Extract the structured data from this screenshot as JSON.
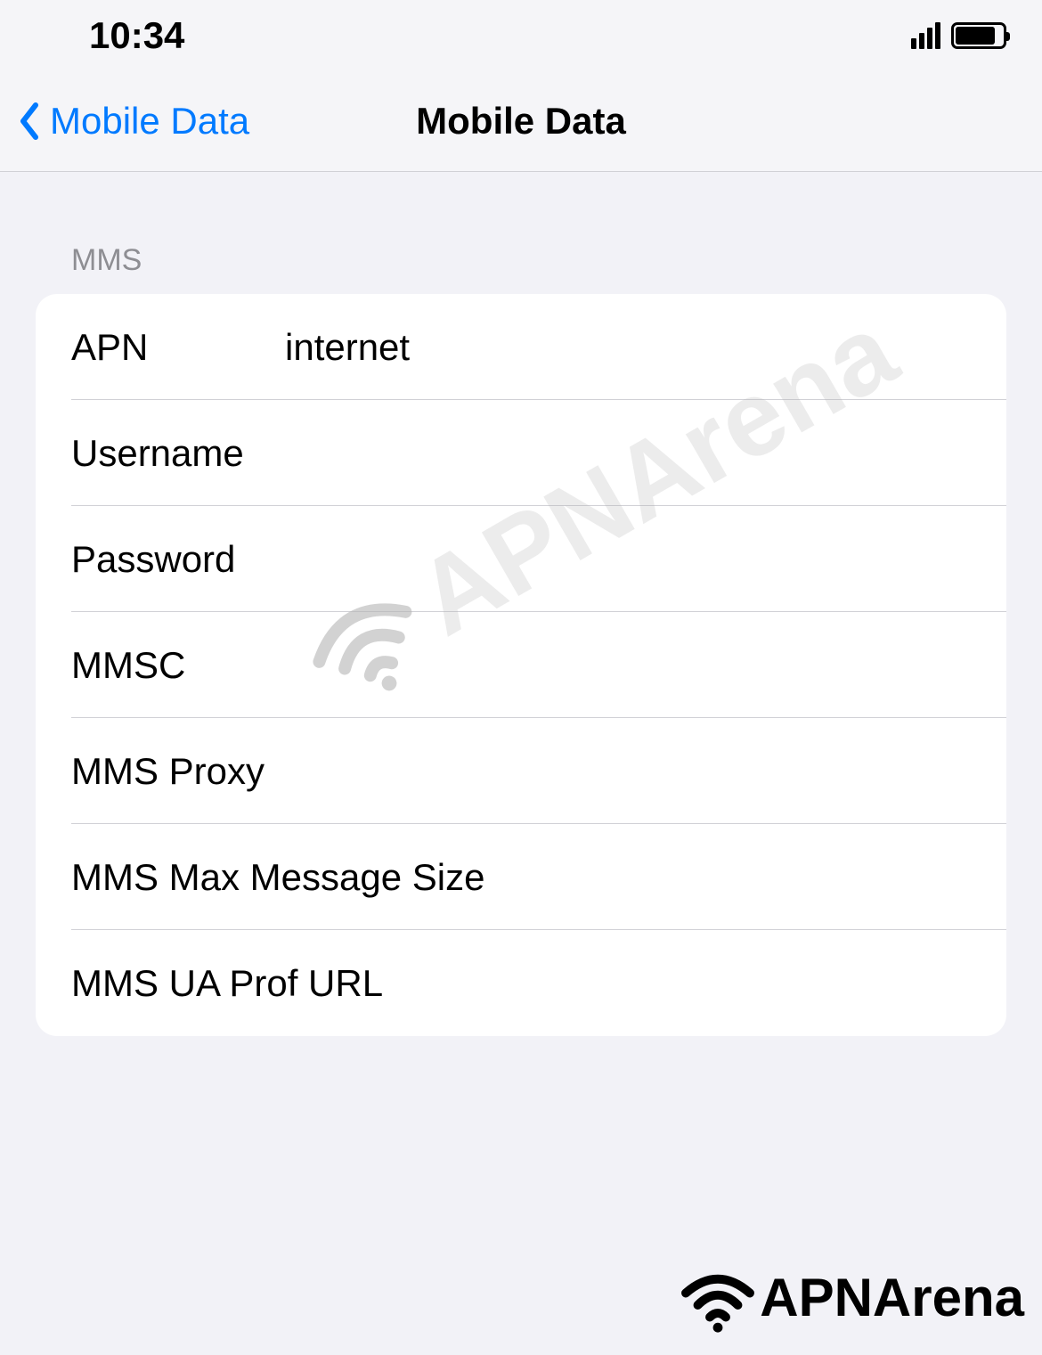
{
  "status_bar": {
    "time": "10:34"
  },
  "nav": {
    "back_label": "Mobile Data",
    "title": "Mobile Data"
  },
  "section": {
    "header": "MMS"
  },
  "rows": {
    "apn": {
      "label": "APN",
      "value": "internet"
    },
    "username": {
      "label": "Username",
      "value": ""
    },
    "password": {
      "label": "Password",
      "value": ""
    },
    "mmsc": {
      "label": "MMSC",
      "value": ""
    },
    "mms_proxy": {
      "label": "MMS Proxy",
      "value": ""
    },
    "mms_max_size": {
      "label": "MMS Max Message Size",
      "value": ""
    },
    "mms_ua_prof": {
      "label": "MMS UA Prof URL",
      "value": ""
    }
  },
  "watermark": {
    "text": "APNArena"
  },
  "logo": {
    "text": "APNArena"
  }
}
